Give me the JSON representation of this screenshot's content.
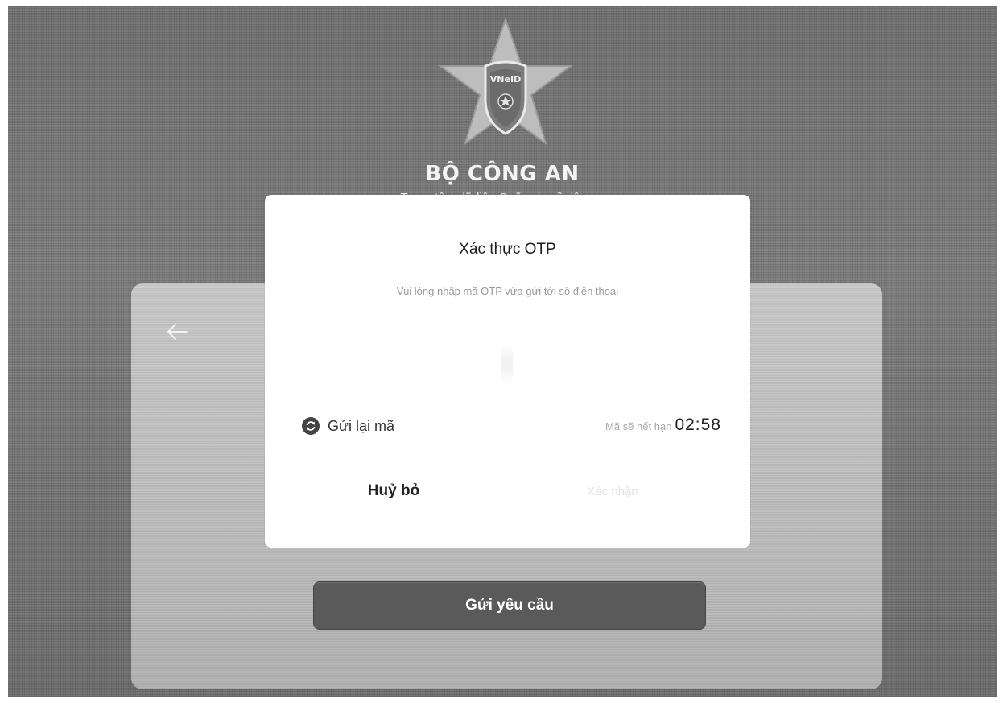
{
  "header": {
    "logo_text": "VNeID",
    "org_title": "BỘ CÔNG AN",
    "org_subtitle": "Trung tâm dữ liệu Quốc gia về dân cư"
  },
  "form": {
    "back_icon": "arrow-left-icon",
    "submit_label": "Gửi yêu cầu"
  },
  "otp_dialog": {
    "title": "Xác thực OTP",
    "description": "Vui lòng nhập mã OTP vừa gửi tới số điện thoại",
    "resend_icon": "refresh-icon",
    "resend_label": "Gửi lại mã",
    "expiry_label": "Mã sẽ hết hạn",
    "expiry_time": "02:58",
    "cancel_label": "Huỷ bỏ",
    "confirm_label": "Xác nhận"
  },
  "colors": {
    "background": "#707070",
    "card": "#c2c2c2",
    "submit_button": "#5a5a5a",
    "dialog": "#ffffff",
    "confirm_disabled_text": "#e2e2e2"
  }
}
